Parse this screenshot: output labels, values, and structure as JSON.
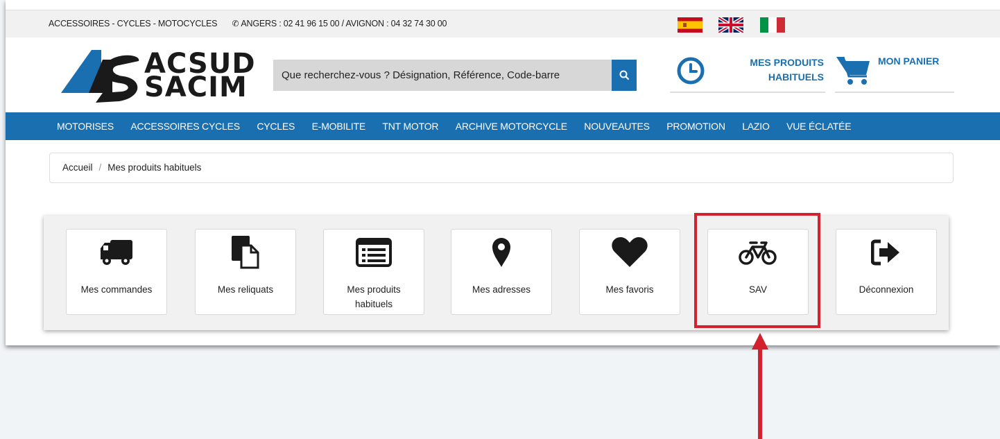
{
  "topbar": {
    "links": "ACCESSOIRES - CYCLES - MOTOCYCLES",
    "phone": "ANGERS : 02 41 96 15 00 / AVIGNON : 04 32 74 30 00",
    "flags": [
      "es",
      "uk",
      "it"
    ]
  },
  "logo": {
    "line1": "ACSUD",
    "line2": "SACIM"
  },
  "search": {
    "placeholder": "Que recherchez-vous ? Désignation, Référence, Code-barre"
  },
  "header": {
    "history_line1": "MES PRODUITS",
    "history_line2": "HABITUELS",
    "cart": "MON PANIER"
  },
  "nav": [
    "MOTORISES",
    "ACCESSOIRES CYCLES",
    "CYCLES",
    "E-MOBILITE",
    "TNT MOTOR",
    "ARCHIVE MOTORCYCLE",
    "NOUVEAUTES",
    "PROMOTION",
    "LAZIO",
    "VUE ÉCLATÉE"
  ],
  "breadcrumb": {
    "home": "Accueil",
    "current": "Mes produits habituels"
  },
  "account_menu": [
    {
      "label": "Mes commandes",
      "icon": "truck-icon"
    },
    {
      "label": "Mes reliquats",
      "icon": "files-icon"
    },
    {
      "label": "Mes produits habituels",
      "icon": "list-icon"
    },
    {
      "label": "Mes adresses",
      "icon": "map-marker-icon"
    },
    {
      "label": "Mes favoris",
      "icon": "heart-icon"
    },
    {
      "label": "SAV",
      "icon": "bicycle-icon"
    },
    {
      "label": "Déconnexion",
      "icon": "sign-out-icon"
    }
  ],
  "colors": {
    "primary": "#1a6fb0",
    "annotation": "#d1222e"
  }
}
